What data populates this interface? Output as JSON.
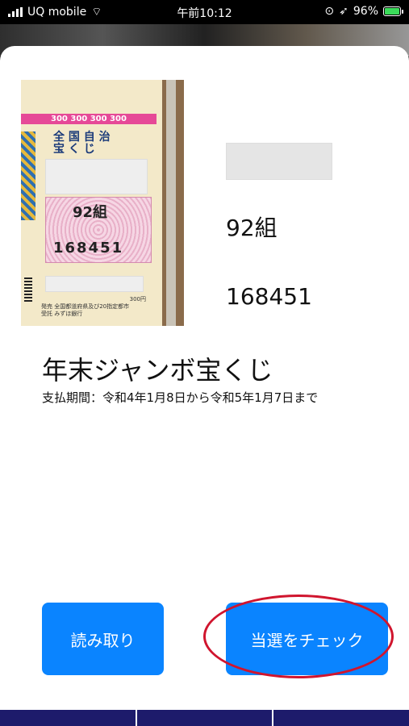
{
  "status_bar": {
    "carrier": "UQ mobile",
    "time": "午前10:12",
    "battery": "96%"
  },
  "ticket_image": {
    "price_row": "300 300 300 300",
    "title_lines": [
      "全 国 自 治",
      "宝 く じ"
    ],
    "group": "92組",
    "number": "168451",
    "seller_text": "発売 全国都道府県及び20指定都市",
    "bank": "受託 みずほ銀行",
    "price_label": "300円"
  },
  "details": {
    "group": "92組",
    "number": "168451",
    "lottery_name": "年末ジャンボ宝くじ",
    "payment_period": "支払期間：令和4年1月8日から令和5年1月7日まで"
  },
  "buttons": {
    "read": "読み取り",
    "check": "当選をチェック"
  },
  "colors": {
    "button_blue": "#0a84ff",
    "highlight_red": "#d0152e",
    "tabbar": "#1d1b6b"
  }
}
